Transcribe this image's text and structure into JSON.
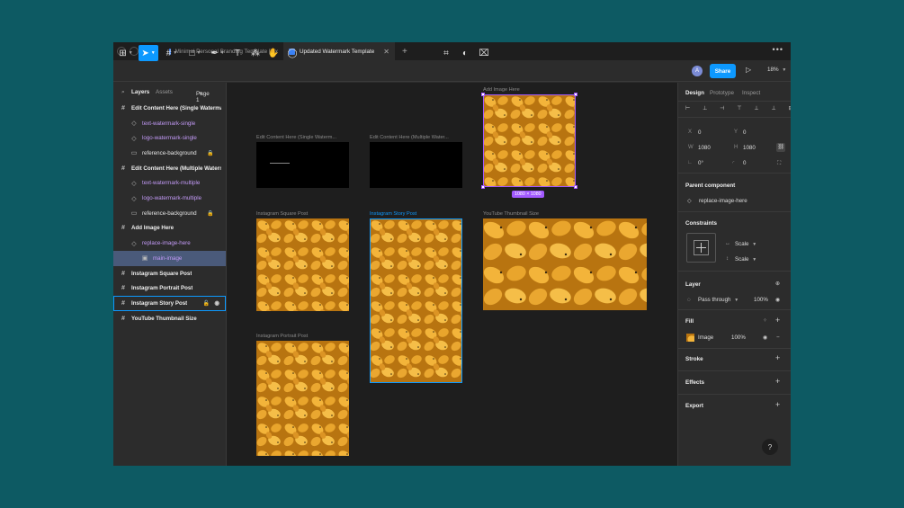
{
  "tabs": [
    {
      "label": "Minimal Personal Branding Template [tex"
    },
    {
      "label": "Updated Watermark Template"
    }
  ],
  "toolbar": {
    "share": "Share",
    "zoom": "18%",
    "avatar": "A"
  },
  "left": {
    "tab_layers": "Layers",
    "tab_assets": "Assets",
    "page": "Page 1",
    "layers": [
      {
        "label": "Edit Content Here (Single Watermark)",
        "kind": "frame"
      },
      {
        "label": "text-watermark-single",
        "kind": "comp"
      },
      {
        "label": "logo-watermark-single",
        "kind": "comp"
      },
      {
        "label": "reference-background",
        "kind": "rect"
      },
      {
        "label": "Edit Content Here (Multiple Watermarks)",
        "kind": "frame"
      },
      {
        "label": "text-watermark-multiple",
        "kind": "comp"
      },
      {
        "label": "logo-watermark-multiple",
        "kind": "comp"
      },
      {
        "label": "reference-background",
        "kind": "rect"
      },
      {
        "label": "Add Image Here",
        "kind": "frame"
      },
      {
        "label": "replace-image-here",
        "kind": "comp"
      },
      {
        "label": "main-image",
        "kind": "image"
      },
      {
        "label": "Instagram Square Post",
        "kind": "frame"
      },
      {
        "label": "Instagram Portrait Post",
        "kind": "frame"
      },
      {
        "label": "Instagram Story Post",
        "kind": "frame"
      },
      {
        "label": "YouTube Thumbnail Size",
        "kind": "frame"
      }
    ]
  },
  "canvas": {
    "labels": {
      "add_image": "Add Image Here",
      "edit_single": "Edit Content Here (Single Waterm...",
      "edit_multiple": "Edit Content Here (Multiple Water...",
      "ig_square": "Instagram Square Post",
      "ig_story": "Instagram Story Post",
      "yt": "YouTube Thumbnail Size",
      "ig_portrait": "Instagram Portrait Post"
    },
    "dimension_tag": "1080 × 1080"
  },
  "right": {
    "tabs": [
      "Design",
      "Prototype",
      "Inspect"
    ],
    "x_label": "X",
    "x": "0",
    "y_label": "Y",
    "y": "0",
    "w_label": "W",
    "w": "1080",
    "h_label": "H",
    "h": "1080",
    "rotation": "0°",
    "radius": "0",
    "parent_component_title": "Parent component",
    "parent_component": "replace-image-here",
    "constraints_title": "Constraints",
    "constraint_h": "Scale",
    "constraint_v": "Scale",
    "layer_title": "Layer",
    "blend": "Pass through",
    "opacity": "100%",
    "fill_title": "Fill",
    "fill_type": "Image",
    "fill_opacity": "100%",
    "stroke_title": "Stroke",
    "effects_title": "Effects",
    "export_title": "Export"
  },
  "colors": {
    "accent": "#0d99ff",
    "component": "#a259ff",
    "background": "#0d5a63"
  }
}
